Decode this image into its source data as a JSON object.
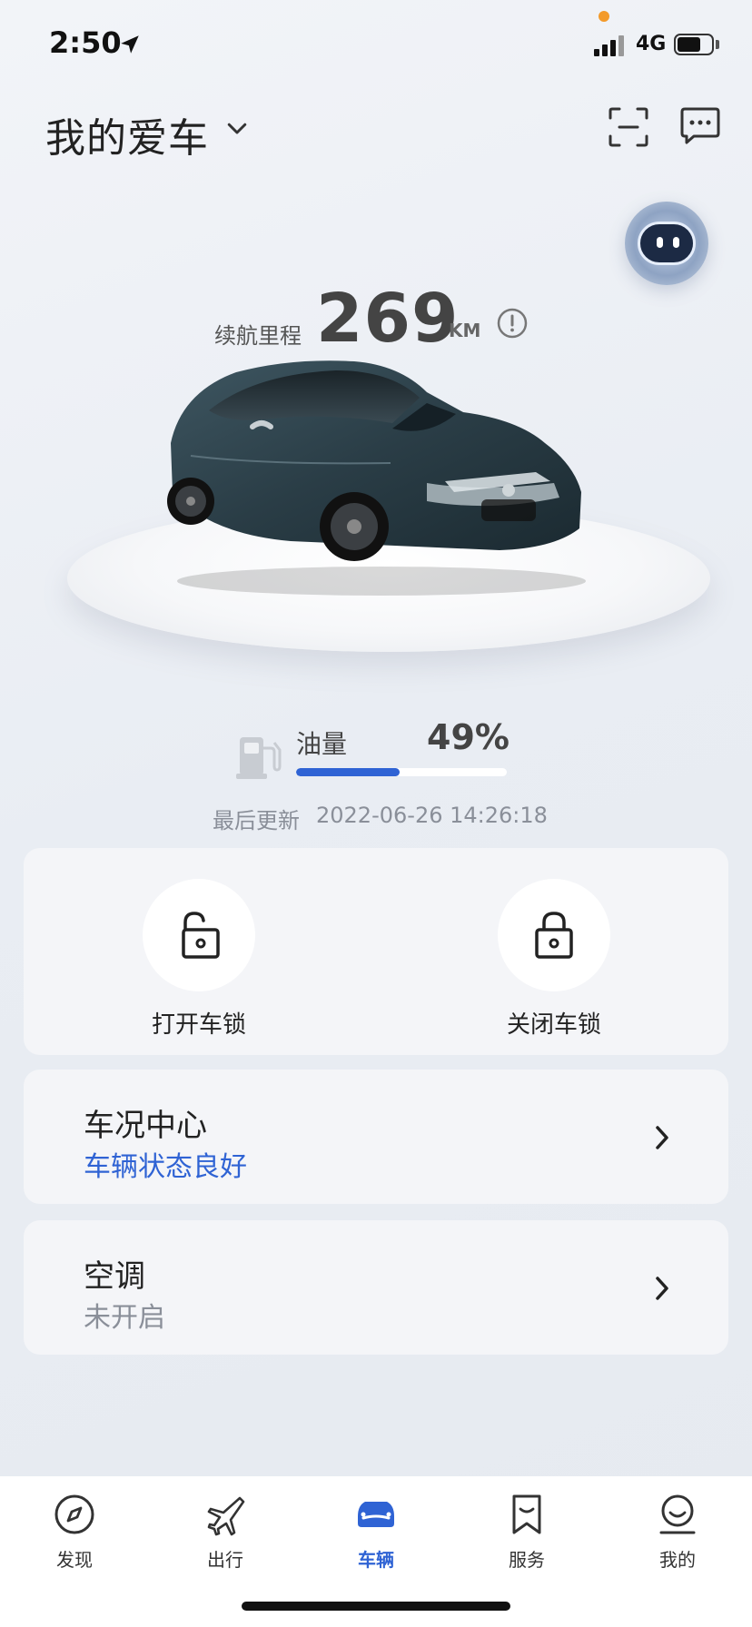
{
  "status_bar": {
    "time": "2:50",
    "network": "4G"
  },
  "header": {
    "title": "我的爱车"
  },
  "range": {
    "label": "续航里程",
    "value": "269",
    "unit": "KM"
  },
  "fuel": {
    "label": "油量",
    "value": "49%",
    "level": 0.49
  },
  "last_update": {
    "label": "最后更新",
    "value": "2022-06-26 14:26:18"
  },
  "lock": {
    "unlock_label": "打开车锁",
    "lock_label": "关闭车锁"
  },
  "vehicle_status": {
    "title": "车况中心",
    "status": "车辆状态良好"
  },
  "air_conditioning": {
    "title": "空调",
    "status": "未开启"
  },
  "tabs": [
    {
      "label": "发现"
    },
    {
      "label": "出行"
    },
    {
      "label": "车辆"
    },
    {
      "label": "服务"
    },
    {
      "label": "我的"
    }
  ],
  "colors": {
    "accent": "#2f63d4",
    "active_tab": "#2f63d4"
  }
}
